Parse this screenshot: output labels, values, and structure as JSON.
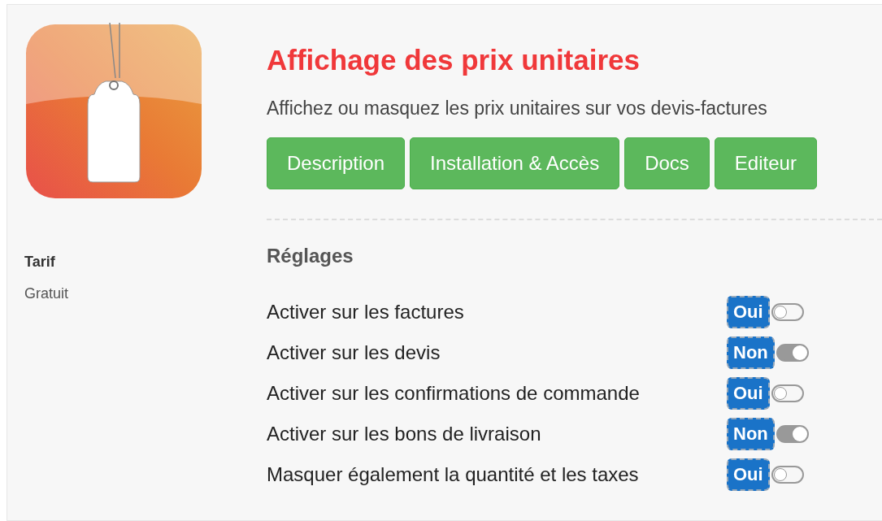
{
  "app": {
    "title": "Affichage des prix unitaires",
    "subtitle": "Affichez ou masquez les prix unitaires sur vos devis-factures"
  },
  "buttons": [
    {
      "label": "Description"
    },
    {
      "label": "Installation & Accès"
    },
    {
      "label": "Docs"
    },
    {
      "label": "Editeur"
    }
  ],
  "pricing": {
    "label": "Tarif",
    "value": "Gratuit"
  },
  "settings": {
    "heading": "Réglages",
    "rows": [
      {
        "label": "Activer sur les factures",
        "badge": "Oui",
        "on": false
      },
      {
        "label": "Activer sur les devis",
        "badge": "Non",
        "on": true
      },
      {
        "label": "Activer sur les confirmations de commande",
        "badge": "Oui",
        "on": false
      },
      {
        "label": "Activer sur les bons de livraison",
        "badge": "Non",
        "on": true
      },
      {
        "label": "Masquer également la quantité et les taxes",
        "badge": "Oui",
        "on": false
      }
    ]
  }
}
